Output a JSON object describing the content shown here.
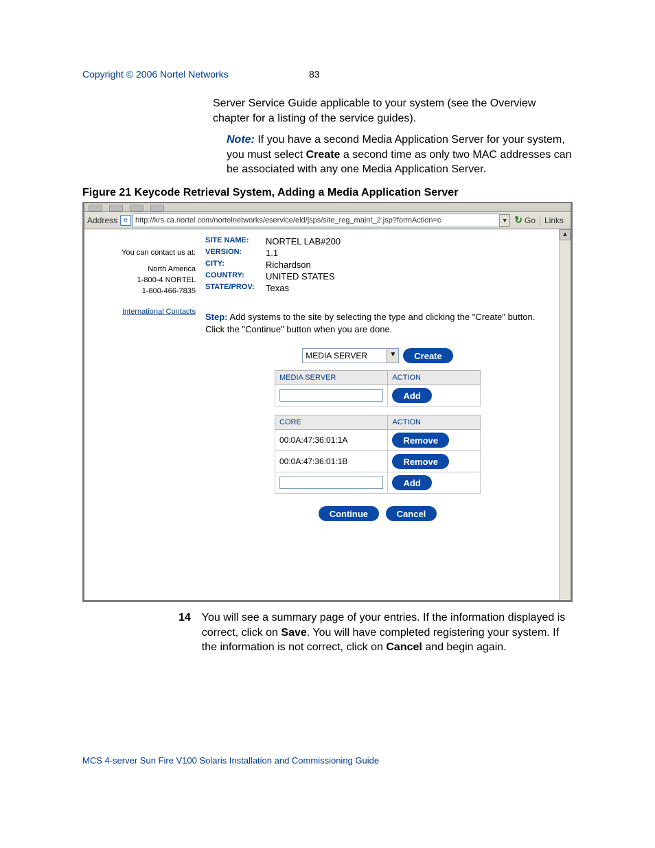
{
  "header": {
    "copyright": "Copyright © 2006 Nortel Networks",
    "page_number": "83"
  },
  "para_top": "Server Service Guide applicable to your system (see the Overview chapter for a listing of the service guides).",
  "note": {
    "label": "Note:",
    "before_bold": "If you have a second Media Application Server for your system, you must select ",
    "bold": "Create",
    "after_bold": " a second time as only two MAC addresses can be associated with any one Media Application Server."
  },
  "figure_title": "Figure 21  Keycode Retrieval System, Adding a Media Application Server",
  "browser": {
    "address_label": "Address",
    "url": "http://krs.ca.nortel.com/nortelnetworks/eservice/eld/jsps/site_reg_maint_2.jsp?formAction=c",
    "go": "Go",
    "links": "Links"
  },
  "sidebar": {
    "contact_label": "You can contact us at:",
    "region": "North America",
    "phone1": "1-800-4 NORTEL",
    "phone2": "1-800-466-7835",
    "intl_link": "International Contacts"
  },
  "site": {
    "site_name_key": "SITE NAME:",
    "site_name_val": "NORTEL LAB#200",
    "version_key": "VERSION:",
    "version_val": "1.1",
    "city_key": "CITY:",
    "city_val": "Richardson",
    "country_key": "COUNTRY:",
    "country_val": "UNITED STATES",
    "state_key": "STATE/PROV:",
    "state_val": "Texas"
  },
  "step": {
    "label": "Step:",
    "text": "Add systems to the site by selecting the type and clicking the \"Create\" button. Click the \"Continue\" button when you are done."
  },
  "type_select": {
    "value": "MEDIA SERVER"
  },
  "buttons": {
    "create": "Create",
    "add": "Add",
    "remove": "Remove",
    "continue": "Continue",
    "cancel": "Cancel"
  },
  "tables": {
    "media": {
      "col1": "MEDIA SERVER",
      "col2": "ACTION"
    },
    "core": {
      "col1": "CORE",
      "col2": "ACTION",
      "row1": "00:0A:47:36:01:1A",
      "row2": "00:0A:47:36:01:1B"
    }
  },
  "step14": {
    "num": "14",
    "t1": "You will see a summary page of your entries. If the information displayed is correct, click on ",
    "b1": "Save",
    "t2": ". You will have completed registering your system. If the information is not correct, click on ",
    "b2": "Cancel",
    "t3": " and begin again."
  },
  "footer": "MCS 4-server Sun Fire V100 Solaris Installation and Commissioning Guide"
}
